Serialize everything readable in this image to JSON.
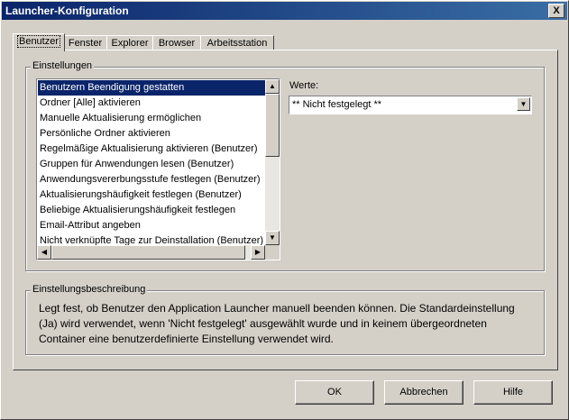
{
  "window": {
    "title": "Launcher-Konfiguration",
    "close_glyph": "X"
  },
  "tabs": [
    {
      "label": "Benutzer",
      "active": true
    },
    {
      "label": "Fenster",
      "active": false
    },
    {
      "label": "Explorer",
      "active": false
    },
    {
      "label": "Browser",
      "active": false
    },
    {
      "label": "Arbeitsstation",
      "active": false
    }
  ],
  "settings_group": {
    "label": "Einstellungen"
  },
  "settings_list": [
    "Benutzern Beendigung gestatten",
    "Ordner [Alle] aktivieren",
    "Manuelle Aktualisierung ermöglichen",
    "Persönliche Ordner aktivieren",
    "Regelmäßige Aktualisierung aktivieren (Benutzer)",
    "Gruppen für Anwendungen lesen (Benutzer)",
    "Anwendungsvererbungsstufe festlegen (Benutzer)",
    "Aktualisierungshäufigkeit festlegen (Benutzer)",
    "Beliebige Aktualisierungshäufigkeit festlegen",
    "Email-Attribut angeben",
    "Nicht verknüpfte Tage zur Deinstallation (Benutzer)"
  ],
  "selected_index": 0,
  "values": {
    "label": "Werte:",
    "current": "** Nicht festgelegt **"
  },
  "description_group": {
    "label": "Einstellungsbeschreibung",
    "text": "Legt fest, ob Benutzer den Application Launcher manuell beenden können. Die Standardeinstellung (Ja) wird verwendet, wenn 'Nicht festgelegt' ausgewählt wurde und in keinem übergeordneten Container eine benutzerdefinierte Einstellung verwendet wird."
  },
  "buttons": {
    "ok": "OK",
    "cancel": "Abbrechen",
    "help": "Hilfe"
  }
}
